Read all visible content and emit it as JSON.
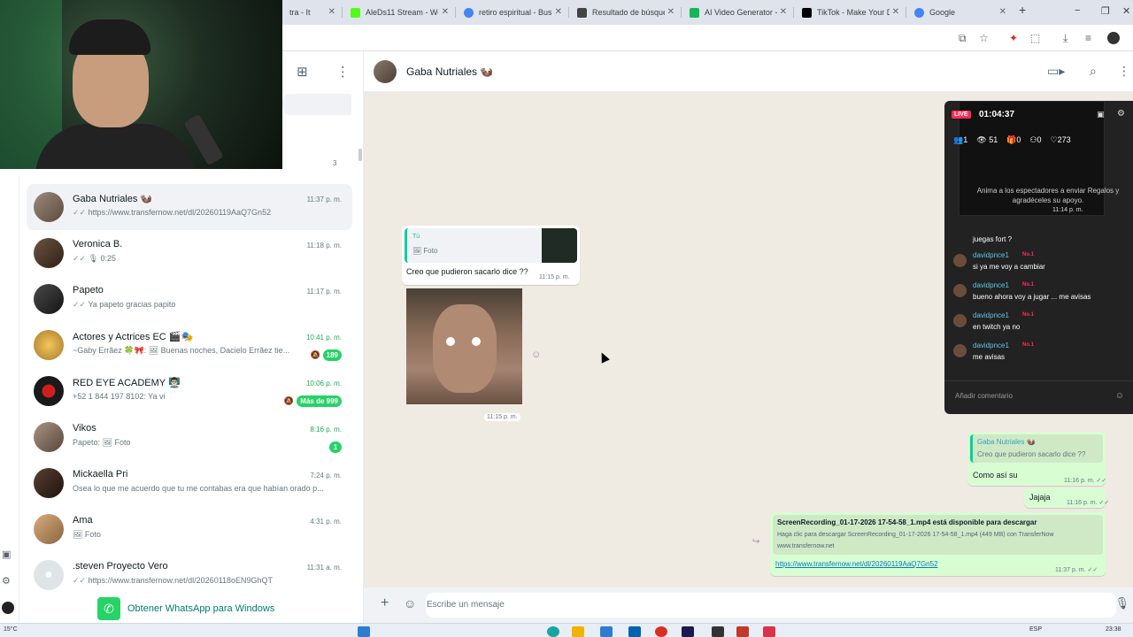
{
  "browser": {
    "tabs": [
      {
        "title": "tra - It",
        "color": "#9146ff"
      },
      {
        "title": "AleDs11 Stream - We",
        "color": "#53fc18"
      },
      {
        "title": "retiro espiritual - Bus",
        "color": "#4285f4"
      },
      {
        "title": "Resultado de búsque",
        "color": "#444444"
      },
      {
        "title": "AI Video Generator -",
        "color": "#15b65a"
      },
      {
        "title": "TikTok - Make Your D",
        "color": "#010101"
      },
      {
        "title": "Google",
        "color": "#4285f4"
      }
    ],
    "new_tab": "+",
    "window_controls": [
      "−",
      "❐",
      "✕"
    ]
  },
  "sidebar": {
    "header_icons": [
      "new-chat-icon",
      "menu-icon"
    ],
    "archived_count": "3",
    "chats": [
      {
        "name": "Gaba Nutriales 🦦",
        "ticks": "✓✓",
        "preview": "https://www.transfernow.net/dl/20260119AaQ7Gn52",
        "time": "11:37 p. m.",
        "avatar": "#7a6a5d"
      },
      {
        "name": "Veronica B.",
        "ticks": "✓✓",
        "preview": "🎙 0:25",
        "time": "11:18 p. m.",
        "avatar": "#4a3a2a"
      },
      {
        "name": "Papeto",
        "ticks": "✓✓",
        "preview": "Ya papeto gracias papito",
        "time": "11:17 p. m.",
        "avatar": "#2d2d2d"
      },
      {
        "name": "Actores y Actrices EC 🎬🎭",
        "ticks": "",
        "preview": "~Gaby Errãez 🍀🎀: 🖼 Buenas noches, Dacielo Errãez tie...",
        "time": "10:41 p. m.",
        "time_green": true,
        "badge": "189",
        "muted": true,
        "avatar": "#caa253"
      },
      {
        "name": "RED EYE ACADEMY 👨🏻‍🏫",
        "ticks": "",
        "preview": "+52 1 844 197 8102: Ya vi",
        "time": "10:06 p. m.",
        "time_green": true,
        "badge": "Más de 999",
        "muted": true,
        "avatar": "#1a1a1a"
      },
      {
        "name": "Vikos",
        "ticks": "",
        "preview": "Papeto: 🖼 Foto",
        "time": "8:16 p. m.",
        "time_green": true,
        "badge": "1",
        "avatar": "#8d7b6a"
      },
      {
        "name": "Mickaella Pri",
        "ticks": "",
        "preview": "Osea lo que me acuerdo que tu me contabas era que habían orado p...",
        "time": "7:24 p. m.",
        "avatar": "#3a2a22"
      },
      {
        "name": "Ama",
        "ticks": "",
        "preview": "🖼 Foto",
        "time": "4:31 p. m.",
        "avatar": "#b98a5e"
      },
      {
        "name": ".steven Proyecto Vero",
        "ticks": "✓✓",
        "preview": "https://www.transfernow.net/dl/20260118oEN9GhQT",
        "time": "11:31 a. m.",
        "avatar": "#dfe5e7"
      }
    ],
    "get_app": "Obtener WhatsApp para Windows"
  },
  "chat": {
    "name": "Gaba Nutriales 🦦",
    "messages": {
      "reply_author": "Tú",
      "reply_preview": "🖼 Foto",
      "reply_text": "Creo que pudieron sacarlo dice ??",
      "reply_time": "11:15 p. m.",
      "image_time": "11:15 p. m.",
      "out_quote_author": "Gaba Nutriales 🦦",
      "out_quote_text": "Creo que pudieron sacarlo dice ??",
      "out_text_1": "Como así su",
      "out_time_1": "11:16 p. m.",
      "out_text_2": "Jajaja",
      "out_time_2": "11:16 p. m.",
      "link_title": "ScreenRecording_01-17-2026 17-54-58_1.mp4 está disponible para descargar",
      "link_desc": "Haga clic para descargar ScreenRecording_01-17-2026 17-54-58_1.mp4 (449 MB) con TransferNow",
      "link_domain": "www.transfernow.net",
      "link_url": "https://www.transfernow.net/dl/20260119AaQ7Gn52",
      "link_time": "11:37 p. m."
    },
    "composer_placeholder": "Escribe un mensaje"
  },
  "live": {
    "badge": "LIVE",
    "timer": "01:04:37",
    "stats": {
      "guests": "1",
      "viewers": "51",
      "gifts": "0",
      "follows": "0",
      "likes": "273"
    },
    "hint": "Anima a los espectadores a enviar Regalos y agradéceles su apoyo.",
    "thumb_time": "11:14 p. m.",
    "first_comment": "juegas fort ?",
    "comments": [
      {
        "user": "davidpnce1",
        "rank": "No.1",
        "text": "si ya me voy a cambiar"
      },
      {
        "user": "davidpnce1",
        "rank": "No.1",
        "text": "bueno ahora voy a jugar ... me avisas"
      },
      {
        "user": "davidpnce1",
        "rank": "No.1",
        "text": "en twitch ya no"
      },
      {
        "user": "davidpnce1",
        "rank": "No.1",
        "text": "me avisas"
      }
    ],
    "input_placeholder": "Añadir comentario"
  },
  "taskbar": {
    "temp": "15°C",
    "lang": "ESP",
    "clock": "23:38"
  }
}
